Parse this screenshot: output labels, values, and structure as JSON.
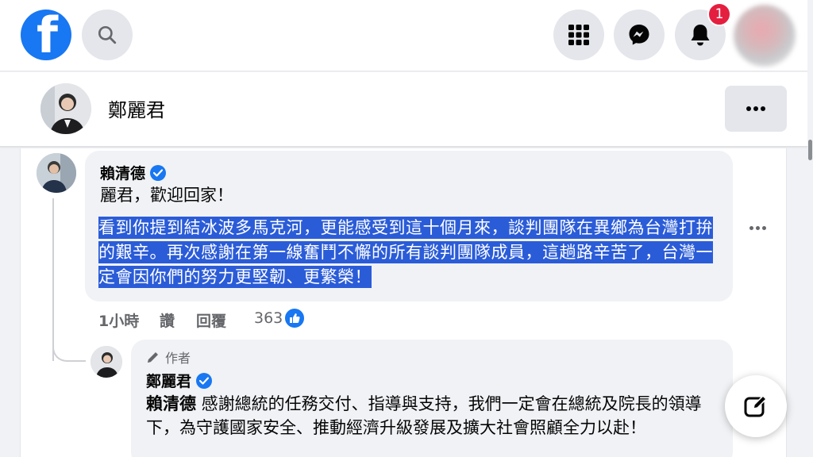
{
  "nav": {
    "logo_letter": "f",
    "notification_count": "1",
    "colors": {
      "brand": "#1877f2",
      "badge": "#e41e3f"
    }
  },
  "page_header": {
    "name": "鄭麗君"
  },
  "comment": {
    "author": "賴清德",
    "greeting": "麗君，歡迎回家！",
    "highlighted_text": "看到你提到結冰波多馬克河，更能感受到這十個月來，談判團隊在異鄉為台灣打拚的艱辛。再次感謝在第一線奮鬥不懈的所有談判團隊成員，這趟路辛苦了，台灣一定會因你們的努力更堅韌、更繁榮！",
    "time": "1小時",
    "read_label": "讚",
    "reply_label": "回覆",
    "reaction_count": "363"
  },
  "reply": {
    "author_tag": "作者",
    "author": "鄭麗君",
    "mention": "賴清德",
    "text": " 感謝總統的任務交付、指導與支持，我們一定會在總統及院長的領導下，為守護國家安全、推動經濟升級發展及擴大社會照顧全力以赴！"
  }
}
